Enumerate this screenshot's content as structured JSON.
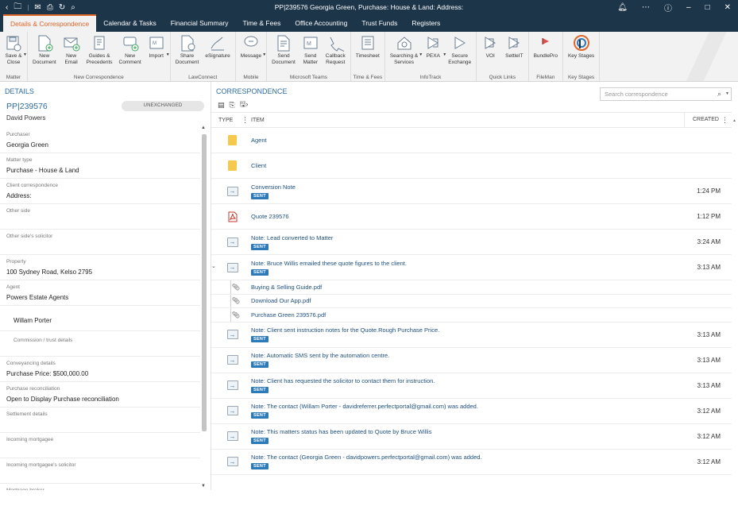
{
  "titlebar": {
    "title": "PP|239576 Georgia Green, Purchase: House & Land: Address:",
    "left_icons": [
      "back-icon",
      "folder-icon",
      "mail-icon",
      "print-icon",
      "refresh-icon",
      "search-icon"
    ],
    "right_icons": [
      "bell-icon",
      "more-icon",
      "help-icon",
      "minimize-icon",
      "maximize-icon",
      "close-icon"
    ]
  },
  "menubar": {
    "tabs": [
      {
        "label": "Details & Correspondence",
        "active": true
      },
      {
        "label": "Calendar & Tasks"
      },
      {
        "label": "Financial Summary"
      },
      {
        "label": "Time & Fees"
      },
      {
        "label": "Office Accounting"
      },
      {
        "label": "Trust Funds"
      },
      {
        "label": "Registers"
      }
    ]
  },
  "ribbon": {
    "groups": [
      {
        "label": "Matter",
        "buttons": [
          {
            "label": "Save &\nClose",
            "icon": "save-close-icon",
            "caret": true
          }
        ]
      },
      {
        "label": "New Correspondence",
        "buttons": [
          {
            "label": "New\nDocument",
            "icon": "new-document-icon"
          },
          {
            "label": "New\nEmail",
            "icon": "new-email-icon"
          },
          {
            "label": "Guides &\nPrecedents",
            "icon": "guides-icon"
          },
          {
            "label": "New\nComment",
            "icon": "new-comment-icon"
          },
          {
            "label": "Import",
            "icon": "import-icon",
            "caret": true
          }
        ]
      },
      {
        "label": "LawConnect",
        "buttons": [
          {
            "label": "Share\nDocument",
            "icon": "share-document-icon"
          },
          {
            "label": "eSignature",
            "icon": "esignature-icon"
          }
        ]
      },
      {
        "label": "Mobile",
        "buttons": [
          {
            "label": "Message",
            "icon": "message-icon",
            "caret": true
          }
        ]
      },
      {
        "label": "Microsoft Teams",
        "buttons": [
          {
            "label": "Send\nDocument",
            "icon": "send-document-icon"
          },
          {
            "label": "Send\nMatter",
            "icon": "send-matter-icon"
          },
          {
            "label": "Callback\nRequest",
            "icon": "callback-icon"
          }
        ]
      },
      {
        "label": "Time & Fees",
        "buttons": [
          {
            "label": "Timesheet",
            "icon": "timesheet-icon"
          }
        ]
      },
      {
        "label": "InfoTrack",
        "buttons": [
          {
            "label": "Searching &\nServices",
            "icon": "searching-icon",
            "caret": true
          },
          {
            "label": "PEXA",
            "icon": "pexa-icon",
            "caret": true
          },
          {
            "label": "Secure\nExchange",
            "icon": "secure-exchange-icon"
          }
        ]
      },
      {
        "label": "Quick Links",
        "buttons": [
          {
            "label": "VOI",
            "icon": "voi-icon"
          },
          {
            "label": "SettleIT",
            "icon": "settleit-icon"
          }
        ]
      },
      {
        "label": "FileMan",
        "buttons": [
          {
            "label": "BundlePro",
            "icon": "bundlepro-icon"
          }
        ]
      },
      {
        "label": "Key Stages",
        "buttons": [
          {
            "label": "Key Stages",
            "icon": "key-stages-icon"
          }
        ]
      }
    ]
  },
  "details": {
    "title": "DETAILS",
    "matter_id": "PP|239576",
    "status": "UNEXCHANGED",
    "client": "David Powers",
    "fields": [
      {
        "label": "Purchaser",
        "value": "Georgia Green"
      },
      {
        "label": "Matter type",
        "value": "Purchase - House & Land"
      },
      {
        "label": "Client correspondence",
        "value": "Address:"
      },
      {
        "label": "Other side",
        "value": ""
      },
      {
        "label": "Other side's solicitor",
        "value": ""
      },
      {
        "label": "Property",
        "value": "100 Sydney Road, Kelso 2795"
      },
      {
        "label": "Agent",
        "value": "Powers Estate Agents"
      },
      {
        "label": "",
        "value": "Willam Porter",
        "kind": "contact"
      },
      {
        "label": "Commission / trust details",
        "value": "",
        "kind": "sub"
      },
      {
        "label": "Conveyancing details",
        "value": "Purchase Price: $500,000.00"
      },
      {
        "label": "Purchase reconciliation",
        "value": "Open to Display Purchase reconciliation"
      },
      {
        "label": "Settlement details",
        "value": ""
      },
      {
        "label": "Incoming mortgagee",
        "value": ""
      },
      {
        "label": "Incoming mortgagee's solicitor",
        "value": ""
      },
      {
        "label": "Mortgage broker",
        "value": ""
      }
    ]
  },
  "correspondence": {
    "title": "CORRESPONDENCE",
    "search_placeholder": "Search correspondence",
    "columns": {
      "type": "TYPE",
      "item": "ITEM",
      "created": "CREATED"
    },
    "rows": [
      {
        "type": "folder",
        "title": "Agent",
        "time": ""
      },
      {
        "type": "folder",
        "title": "Client",
        "time": ""
      },
      {
        "type": "note",
        "title": "Conversion Note",
        "badge": "SENT",
        "time": "1:24 PM"
      },
      {
        "type": "pdf",
        "title": "Quote 239576",
        "time": "1:12 PM"
      },
      {
        "type": "note",
        "title": "Note: Lead converted to Matter",
        "badge": "SENT",
        "time": "3:24 AM"
      },
      {
        "type": "note",
        "title": "Note: Bruce Willis emailed these quote figures to the client.",
        "badge": "SENT",
        "time": "3:13 AM",
        "expanded": true,
        "attachments": [
          "Buying & Selling Guide.pdf",
          "Download Our App.pdf",
          "Purchase Green 239576.pdf"
        ]
      },
      {
        "type": "note",
        "title": "Note: Client sent instruction notes for the Quote.Rough Purchase Price.",
        "badge": "SENT",
        "time": "3:13 AM"
      },
      {
        "type": "note",
        "title": "Note: Automatic SMS sent by the automation centre.",
        "badge": "SENT",
        "time": "3:13 AM"
      },
      {
        "type": "note",
        "title": "Note: Client has requested the solicitor to contact them for instruction.",
        "badge": "SENT",
        "time": "3:13 AM"
      },
      {
        "type": "note",
        "title": "Note: The contact (Willam Porter - davidreferrer.perfectportal@gmail.com) was added.",
        "badge": "SENT",
        "time": "3:12 AM"
      },
      {
        "type": "note",
        "title": "Note: This matters status has been updated to Quote by Bruce Willis",
        "badge": "SENT",
        "time": "3:12 AM"
      },
      {
        "type": "note",
        "title": "Note: The contact (Georgia Green - davidpowers.perfectportal@gmail.com) was added.",
        "badge": "SENT",
        "time": "3:12 AM"
      }
    ]
  },
  "colors": {
    "titlebar": "#1d3549",
    "accent": "#e0672a",
    "link": "#2c6ca3",
    "badge": "#2d7ab8",
    "folder": "#f6c94d"
  }
}
